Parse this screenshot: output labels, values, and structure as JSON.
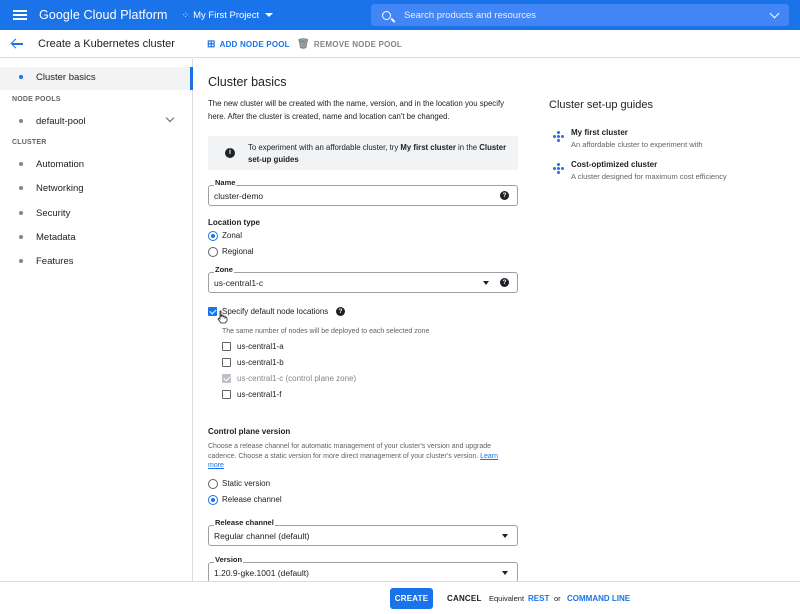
{
  "header": {
    "brand": "Google Cloud Platform",
    "project": "My First Project",
    "search_placeholder": "Search products and resources"
  },
  "subheader": {
    "title": "Create a Kubernetes cluster",
    "add_node_pool": "ADD NODE POOL",
    "remove_node_pool": "REMOVE NODE POOL"
  },
  "sidebar": {
    "active": "Cluster basics",
    "node_pools_heading": "NODE POOLS",
    "node_pool": "default-pool",
    "cluster_heading": "CLUSTER",
    "items": [
      "Automation",
      "Networking",
      "Security",
      "Metadata",
      "Features"
    ]
  },
  "form": {
    "title": "Cluster basics",
    "description": "The new cluster will be created with the name, version, and in the location you specify here. After the cluster is created, name and location can't be changed.",
    "info": {
      "pre": "To experiment with an affordable cluster, try ",
      "bold": "My first cluster",
      "mid": " in the ",
      "bold2": "Cluster set-up guides"
    },
    "name_label": "Name",
    "name_value": "cluster-demo",
    "location_type_label": "Location type",
    "zonal": "Zonal",
    "regional": "Regional",
    "zone_label": "Zone",
    "zone_value": "us-central1-c",
    "specify_label": "Specify default node locations",
    "specify_hint": "The same number of nodes will be deployed to each selected zone",
    "zones": [
      "us-central1-a",
      "us-central1-b",
      "us-central1-c (control plane zone)",
      "us-central1-f"
    ],
    "control_plane_label": "Control plane version",
    "control_plane_desc": "Choose a release channel for automatic management of your cluster's version and upgrade cadence. Choose a static version for more direct management of your cluster's version. ",
    "learn_more": "Learn more",
    "static_version": "Static version",
    "release_channel": "Release channel",
    "release_channel_label": "Release channel",
    "release_channel_value": "Regular channel (default)",
    "version_label": "Version",
    "version_value": "1.20.9-gke.1001 (default)"
  },
  "guides": {
    "title": "Cluster set-up guides",
    "items": [
      {
        "title": "My first cluster",
        "subtitle": "An affordable cluster to experiment with"
      },
      {
        "title": "Cost-optimized cluster",
        "subtitle": "A cluster designed for maximum cost efficiency"
      }
    ]
  },
  "footer": {
    "create": "CREATE",
    "cancel": "CANCEL",
    "equivalent": "Equivalent",
    "rest": "REST",
    "or": "or",
    "command_line": "COMMAND LINE"
  },
  "colors": {
    "primary": "#1a73e8",
    "nav_active_bg": "#f1f3f4"
  }
}
